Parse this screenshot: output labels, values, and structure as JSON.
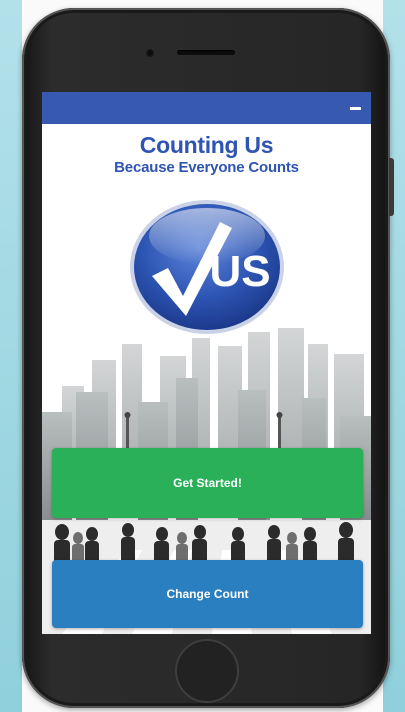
{
  "app": {
    "title": "Counting Us",
    "subtitle": "Because Everyone Counts",
    "logo_text": "US"
  },
  "topbar": {
    "color": "#3859b0",
    "menu_icon": "minus-icon"
  },
  "buttons": {
    "get_started": "Get Started!",
    "change_count": "Change Count"
  },
  "colors": {
    "brand": "#2f55b2",
    "primary_button": "#2bb05a",
    "secondary_button": "#2a7fc0"
  }
}
